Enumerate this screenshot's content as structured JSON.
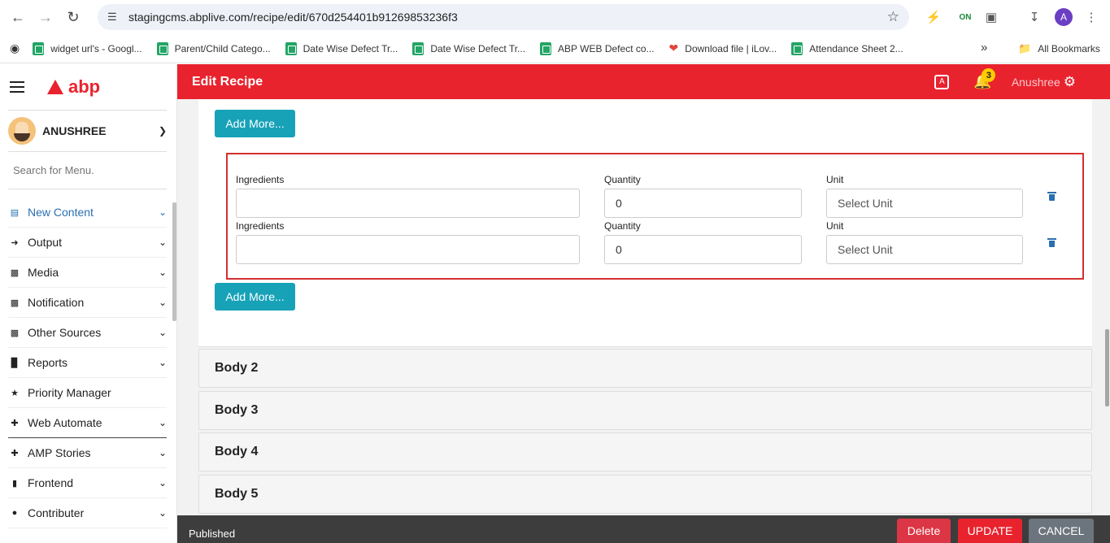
{
  "browser": {
    "url": "stagingcms.abplive.com/recipe/edit/670d254401b91269853236f3",
    "profile_initial": "A",
    "bookmarks": [
      "widget url's - Googl...",
      "Parent/Child Catego...",
      "Date Wise Defect Tr...",
      "Date Wise Defect Tr...",
      "ABP WEB Defect co...",
      "Download file | iLov...",
      "Attendance Sheet 2..."
    ],
    "more_label": "»",
    "all_bookmarks": "All Bookmarks"
  },
  "sidebar": {
    "logo_text": "abp",
    "user_name": "ANUSHREE",
    "search_placeholder": "Search for Menu.",
    "items": [
      {
        "label": "New Content",
        "icon": "book-icon",
        "active": true
      },
      {
        "label": "Output",
        "icon": "sign-out-icon"
      },
      {
        "label": "Media",
        "icon": "sitemap-icon"
      },
      {
        "label": "Notification",
        "icon": "sitemap-icon"
      },
      {
        "label": "Other Sources",
        "icon": "sitemap-icon"
      },
      {
        "label": "Reports",
        "icon": "bar-chart-icon"
      },
      {
        "label": "Priority Manager",
        "icon": "trophy-icon"
      },
      {
        "label": "Web Automate",
        "icon": "move-icon"
      },
      {
        "label": "AMP Stories",
        "icon": "move-icon"
      },
      {
        "label": "Frontend",
        "icon": "file-icon"
      },
      {
        "label": "Contributer",
        "icon": "circle-icon"
      }
    ]
  },
  "header": {
    "title": "Edit Recipe",
    "notification_count": "3",
    "user": "Anushree"
  },
  "recipe": {
    "add_more_label": "Add More...",
    "ingredients_label": "Ingredients",
    "quantity_label": "Quantity",
    "unit_label": "Unit",
    "rows": [
      {
        "ingredient": "",
        "quantity": "0",
        "unit": "Select Unit"
      },
      {
        "ingredient": "",
        "quantity": "0",
        "unit": "Select Unit"
      }
    ],
    "sections": [
      "Body 2",
      "Body 3",
      "Body 4",
      "Body 5"
    ]
  },
  "footer": {
    "status": "Published",
    "delete_label": "Delete",
    "update_label": "UPDATE",
    "cancel_label": "CANCEL"
  },
  "colors": {
    "brand_red": "#e8232e",
    "teal": "#17a2b8",
    "active_blue": "#2a6fb0"
  }
}
